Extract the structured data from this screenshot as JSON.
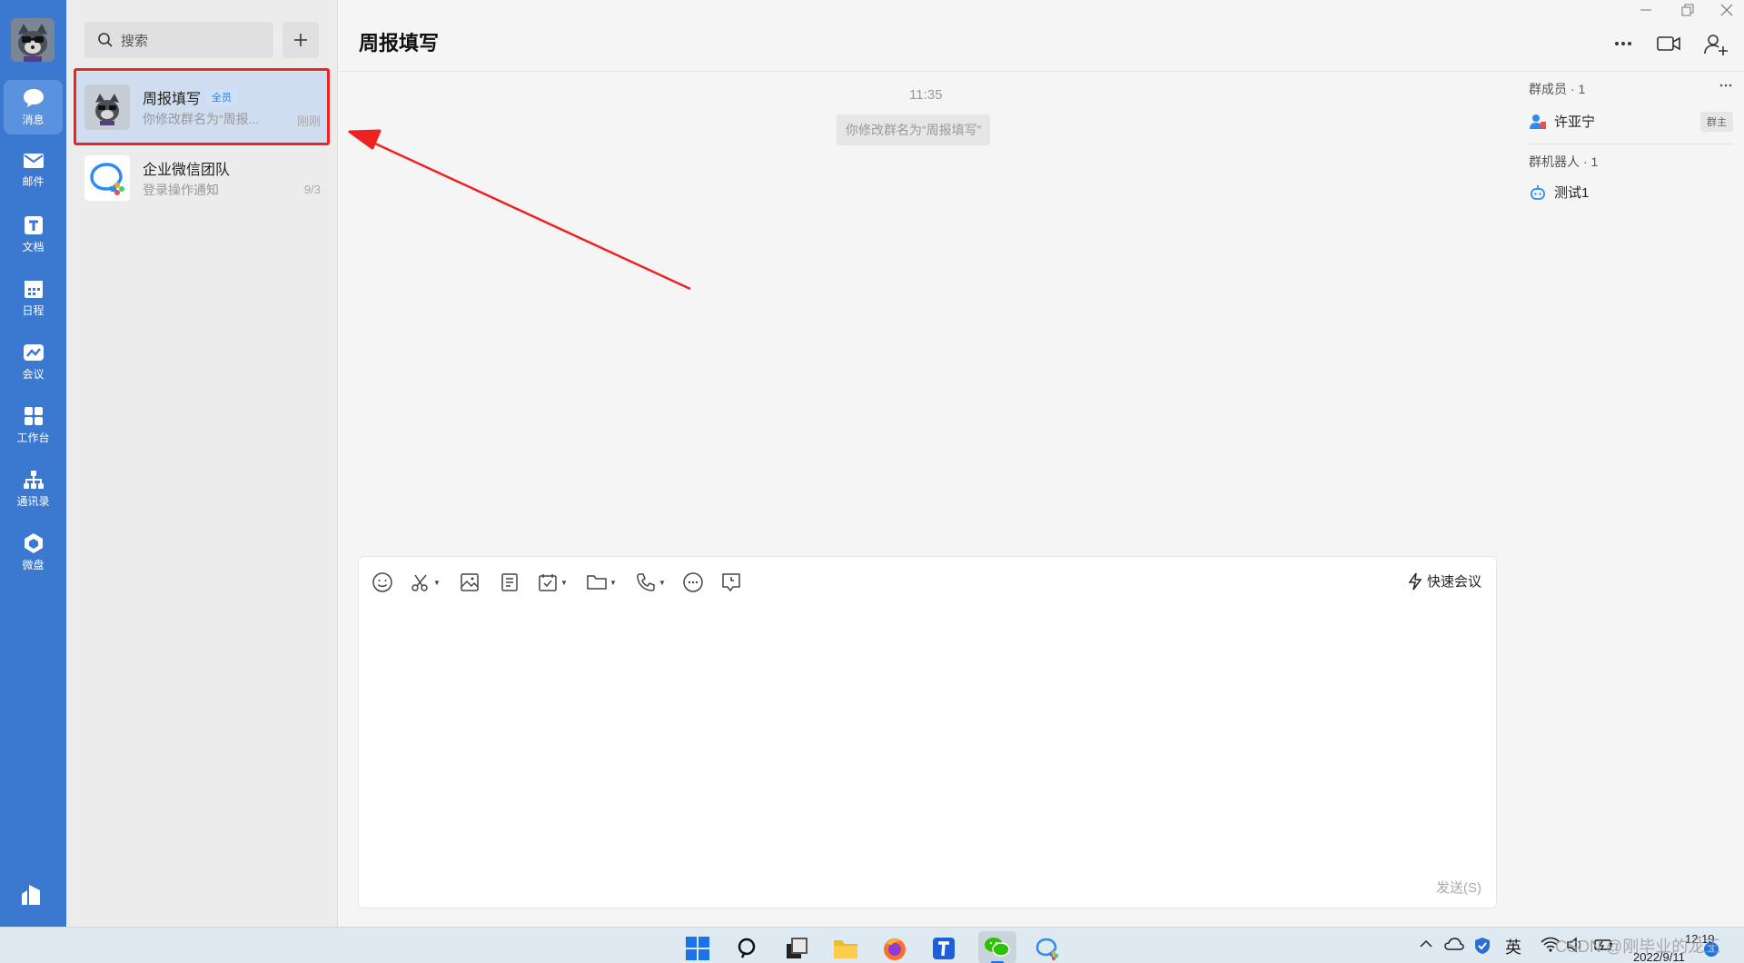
{
  "nav": {
    "items": [
      {
        "label": "消息"
      },
      {
        "label": "邮件"
      },
      {
        "label": "文档"
      },
      {
        "label": "日程"
      },
      {
        "label": "会议"
      },
      {
        "label": "工作台"
      },
      {
        "label": "通讯录"
      },
      {
        "label": "微盘"
      }
    ]
  },
  "list": {
    "search_placeholder": "搜索",
    "chats": [
      {
        "name": "周报填写",
        "badge": "全员",
        "message": "你修改群名为“周报...",
        "time": "刚刚"
      },
      {
        "name": "企业微信团队",
        "message": "登录操作通知",
        "time": "9/3"
      }
    ]
  },
  "header": {
    "title": "周报填写"
  },
  "messages": {
    "timestamp": "11:35",
    "system_message": "你修改群名为“周报填写”"
  },
  "members": {
    "members_label": "群成员 · 1",
    "member_name": "许亚宁",
    "owner_tag": "群主",
    "bots_label": "群机器人 · 1",
    "bot_name": "测试1"
  },
  "composer": {
    "quick_meeting": "快速会议",
    "send": "发送(S)"
  },
  "taskbar": {
    "ime": "英",
    "time": "12:19",
    "date": "2022/9/11",
    "notification_count": "3",
    "watermark": "CSDN @刚毕业的龙王"
  },
  "colors": {
    "nav_bg": "#3b78d0",
    "highlight": "#ee2222",
    "selected_bg": "#d0dcf0"
  }
}
